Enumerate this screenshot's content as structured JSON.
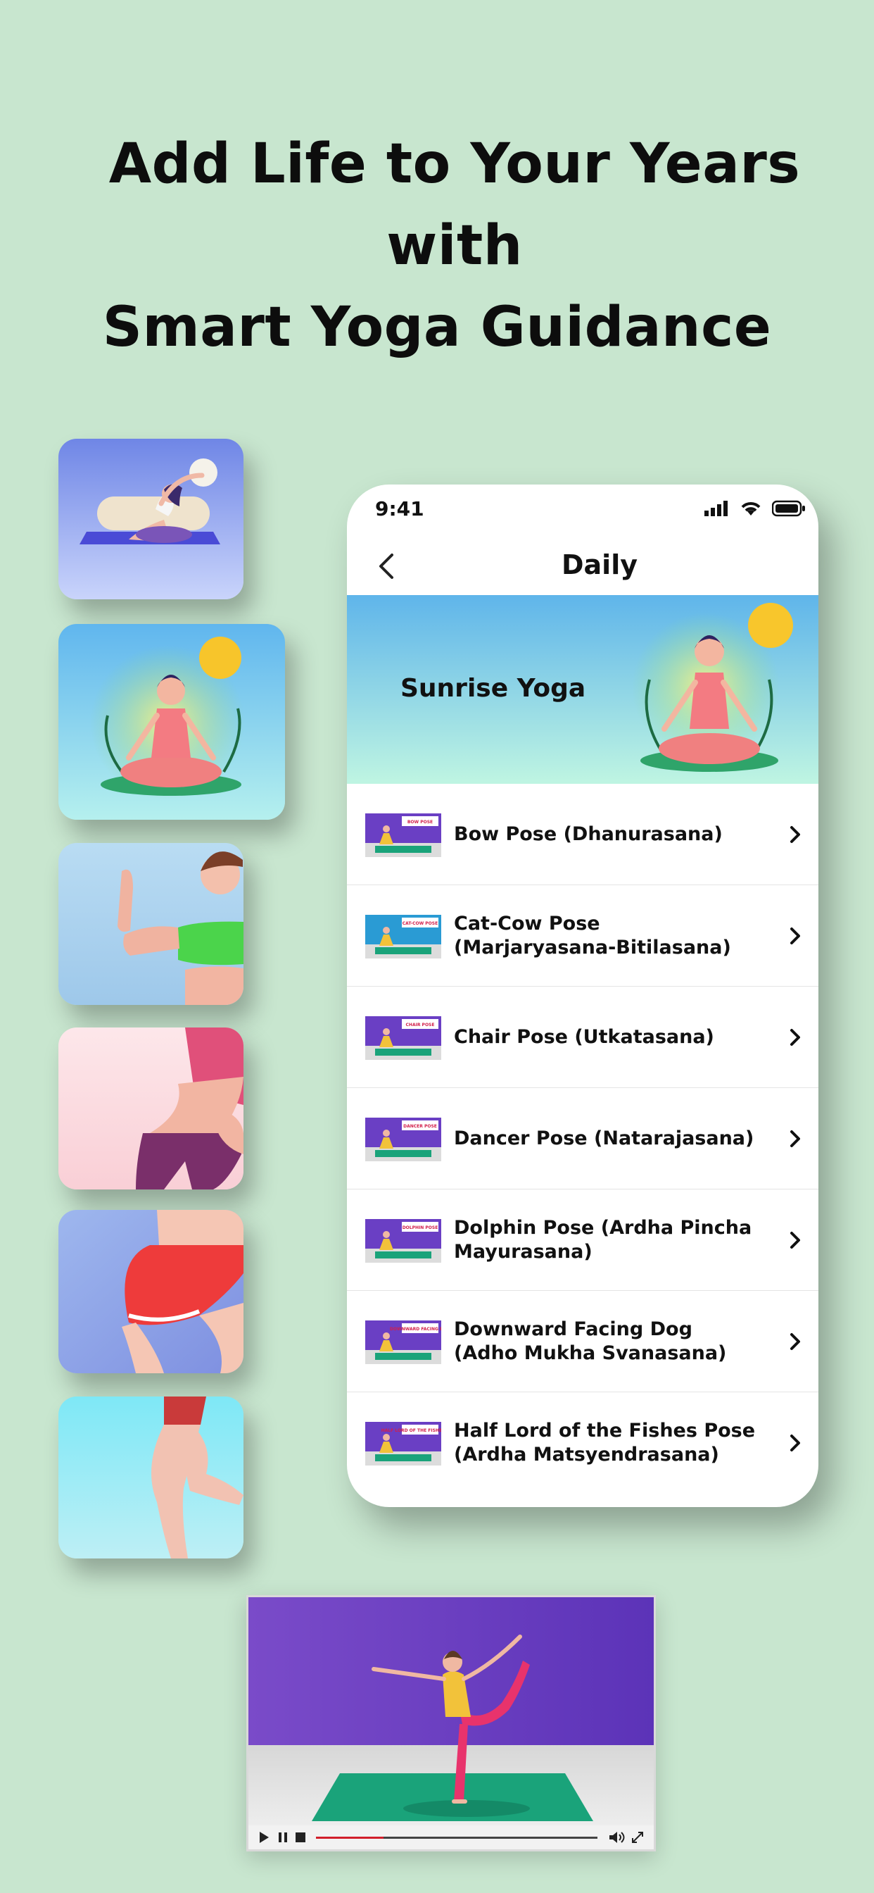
{
  "headline": {
    "line1": "Add Life to Your Years with",
    "line2": "Smart Yoga Guidance"
  },
  "phone": {
    "time": "9:41",
    "title": "Daily",
    "banner_title": "Sunrise Yoga",
    "items": [
      {
        "label": "Bow Pose (Dhanurasana)",
        "thumb_caption": "BOW POSE"
      },
      {
        "label": "Cat-Cow Pose (Marjaryasana-Bitilasana)",
        "thumb_caption": "CAT-COW POSE"
      },
      {
        "label": "Chair Pose (Utkatasana)",
        "thumb_caption": "CHAIR POSE"
      },
      {
        "label": "Dancer Pose (Natarajasana)",
        "thumb_caption": "DANCER POSE"
      },
      {
        "label": "Dolphin Pose (Ardha Pincha Mayurasana)",
        "thumb_caption": "DOLPHIN POSE"
      },
      {
        "label": "Downward Facing Dog (Adho Mukha Svanasana)",
        "thumb_caption": "DOWNWARD FACING DOG"
      },
      {
        "label": "Half Lord of the Fishes Pose (Ardha Matsyendrasana)",
        "thumb_caption": "HALF LORD OF THE FISHES POSE"
      }
    ]
  },
  "icons": {
    "back": "chevron-left-icon",
    "row": "chevron-right-icon",
    "signal": "signal-icon",
    "wifi": "wifi-icon",
    "battery": "battery-icon"
  },
  "video": {
    "progress": 0.24
  },
  "colors": {
    "background": "#c8e6cf",
    "accent_purple": "#6a3fc4",
    "mat_green": "#1aa37a"
  }
}
